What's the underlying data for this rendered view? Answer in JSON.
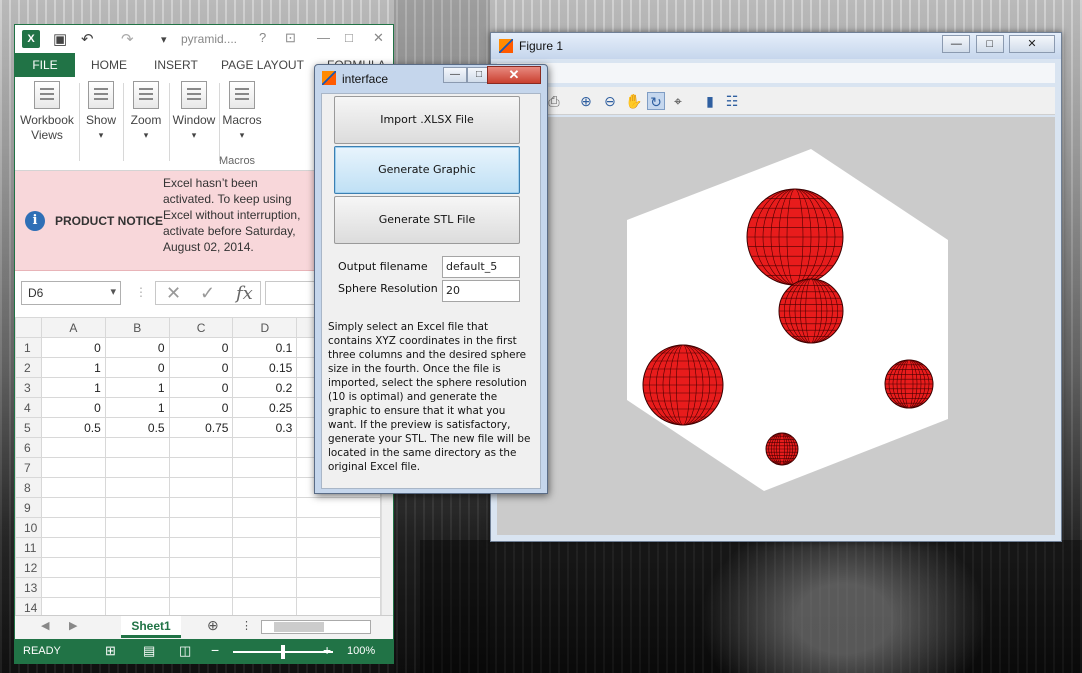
{
  "excel": {
    "title": "pyramid....",
    "tabs": [
      "FILE",
      "HOME",
      "INSERT",
      "PAGE LAYOUT",
      "FORMULA"
    ],
    "ribbon": {
      "workbook_views": "Workbook Views",
      "show": "Show",
      "zoom": "Zoom",
      "window": "Window",
      "macros": "Macros",
      "group_label": "Macros"
    },
    "notice": {
      "title": "PRODUCT NOTICE",
      "message": "Excel hasn’t been activated. To keep using Excel without interruption, activate before Saturday, August 02, 2014."
    },
    "name_box": "D6",
    "fx_symbol": "fx",
    "columns": [
      "A",
      "B",
      "C",
      "D"
    ],
    "rows": [
      {
        "n": "1",
        "cells": [
          "0",
          "0",
          "0",
          "0.1"
        ]
      },
      {
        "n": "2",
        "cells": [
          "1",
          "0",
          "0",
          "0.15"
        ]
      },
      {
        "n": "3",
        "cells": [
          "1",
          "1",
          "0",
          "0.2"
        ]
      },
      {
        "n": "4",
        "cells": [
          "0",
          "1",
          "0",
          "0.25"
        ]
      },
      {
        "n": "5",
        "cells": [
          "0.5",
          "0.5",
          "0.75",
          "0.3"
        ]
      },
      {
        "n": "6",
        "cells": [
          "",
          "",
          "",
          ""
        ]
      },
      {
        "n": "7",
        "cells": [
          "",
          "",
          "",
          ""
        ]
      },
      {
        "n": "8",
        "cells": [
          "",
          "",
          "",
          ""
        ]
      },
      {
        "n": "9",
        "cells": [
          "",
          "",
          "",
          ""
        ]
      },
      {
        "n": "10",
        "cells": [
          "",
          "",
          "",
          ""
        ]
      },
      {
        "n": "11",
        "cells": [
          "",
          "",
          "",
          ""
        ]
      },
      {
        "n": "12",
        "cells": [
          "",
          "",
          "",
          ""
        ]
      },
      {
        "n": "13",
        "cells": [
          "",
          "",
          "",
          ""
        ]
      },
      {
        "n": "14",
        "cells": [
          "",
          "",
          "",
          ""
        ]
      }
    ],
    "sheet_tab": "Sheet1",
    "status": "READY",
    "zoom_level": "100%"
  },
  "figure": {
    "title": "Figure 1",
    "sphere_color": "#e81c1c"
  },
  "interface": {
    "title": "interface",
    "buttons": {
      "import": "Import .XLSX File",
      "generate_graphic": "Generate Graphic",
      "generate_stl": "Generate STL File"
    },
    "output_label": "Output filename",
    "output_value": "default_5",
    "resolution_label": "Sphere Resolution",
    "resolution_value": "20",
    "help_text": "Simply select an Excel file that contains XYZ coordinates in the first three columns and the desired sphere size in the fourth. Once the file is imported, select the sphere resolution (10 is optimal) and generate the graphic to ensure that it what you want. If the preview is satisfactory, generate your STL. The new file will be located in the same directory as the original Excel file."
  }
}
